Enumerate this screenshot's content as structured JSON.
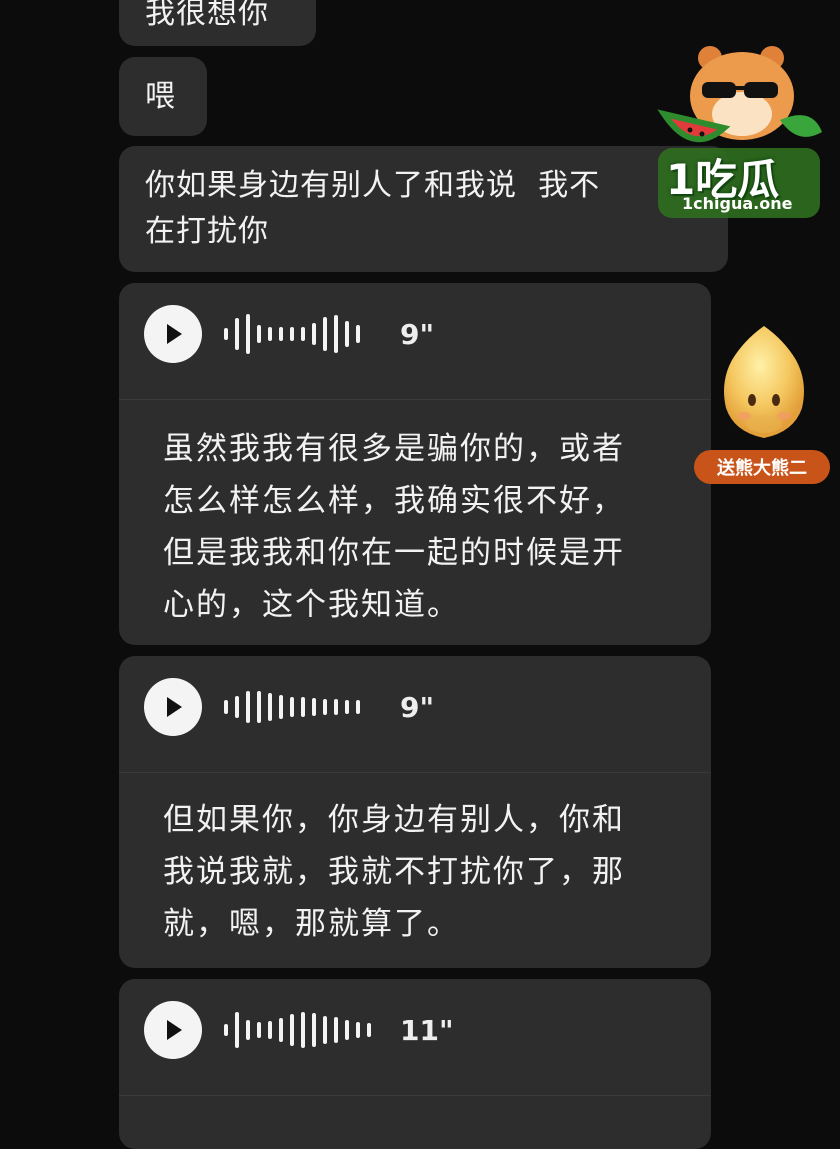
{
  "messages": {
    "m1": {
      "text": "我很想你"
    },
    "m2": {
      "text": "喂"
    },
    "m3": {
      "line1": "你如果身边有别人了和我说  我不",
      "line2": "在打扰你"
    }
  },
  "voice_messages": [
    {
      "duration": "9\"",
      "transcript": [
        "虽然我我有很多是骗你的，或者",
        "怎么样怎么样，我确实很不好，",
        "但是我我和你在一起的时候是开",
        "心的，这个我知道。"
      ]
    },
    {
      "duration": "9\"",
      "transcript": [
        "但如果你，你身边有别人，你和",
        "我说我就，我就不打扰你了，那",
        "就，嗯，那就算了。"
      ]
    },
    {
      "duration": "11\"",
      "transcript": []
    }
  ],
  "watermark": {
    "brand": "1吃瓜",
    "site": "1chigua.one"
  },
  "gift_badge": {
    "label": "送熊大熊二"
  },
  "colors": {
    "bubble": "#2d2d2d",
    "background": "#0c0c0c",
    "play_button": "#f4f4f4",
    "badge": "#c9541a"
  },
  "icons": [
    "play-icon",
    "waveform-icon"
  ]
}
